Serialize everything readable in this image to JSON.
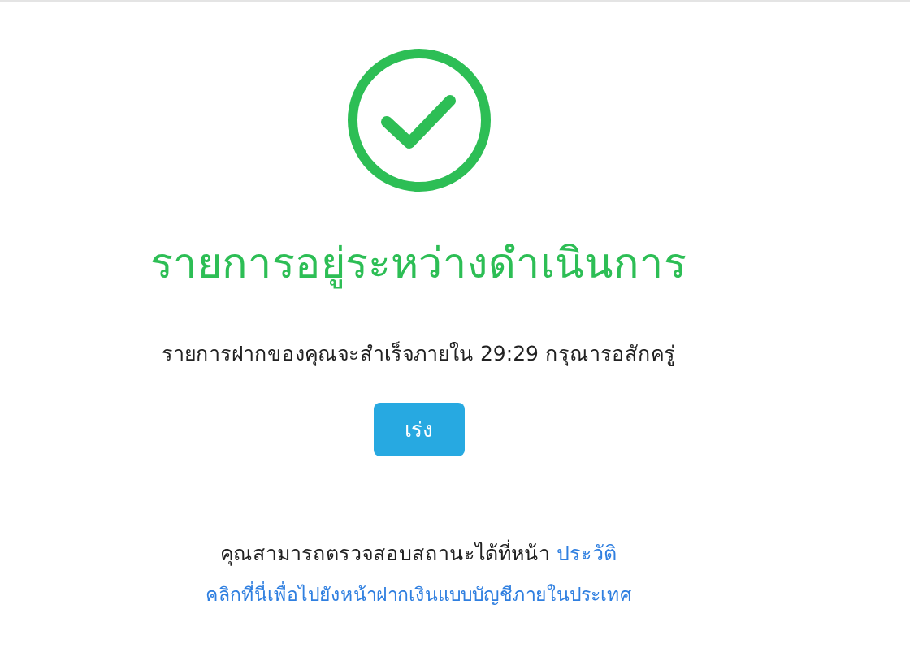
{
  "title": "รายการอยู่ระหว่างดำเนินการ",
  "message": "รายการฝากของคุณจะสำเร็จภายใน 29:29 กรุณารอสักครู่",
  "button": "เร่ง",
  "status_text": "คุณสามารถตรวจสอบสถานะได้ที่หน้า",
  "history_link": "ประวัติ",
  "domestic_link": "คลิกที่นี่เพื่อไปยังหน้าฝากเงินแบบบัญชีภายในประเทศ"
}
